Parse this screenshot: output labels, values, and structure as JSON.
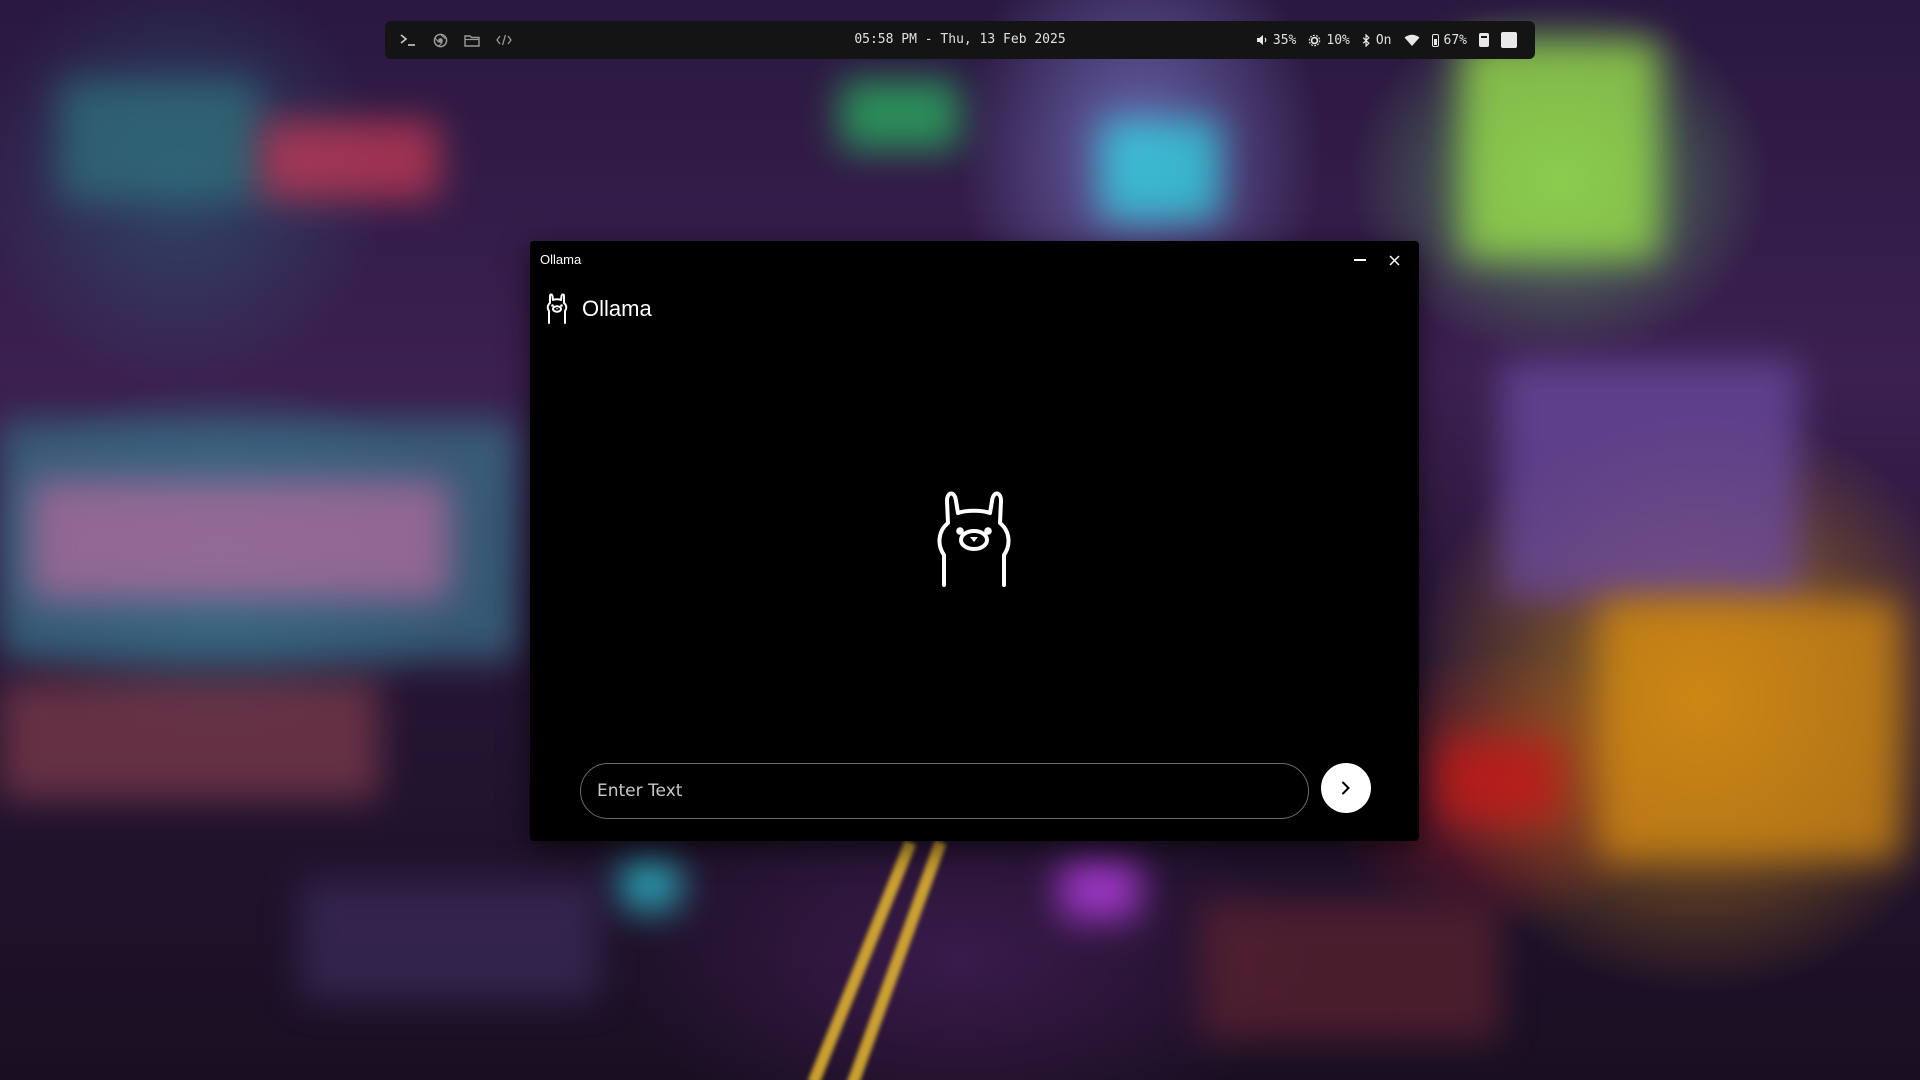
{
  "topbar": {
    "left_icons": [
      "terminal-icon",
      "browser-icon",
      "folder-icon",
      "code-icon"
    ],
    "datetime": "05:58 PM - Thu, 13 Feb 2025",
    "volume": "35%",
    "brightness": "10%",
    "bluetooth": "On",
    "battery": "67%"
  },
  "window": {
    "title": "Ollama",
    "app_name": "Ollama",
    "input": {
      "placeholder": "Enter Text",
      "value": ""
    }
  },
  "colors": {
    "window_bg": "#000000",
    "topbar_bg": "#141414",
    "send_button_bg": "#ffffff"
  }
}
